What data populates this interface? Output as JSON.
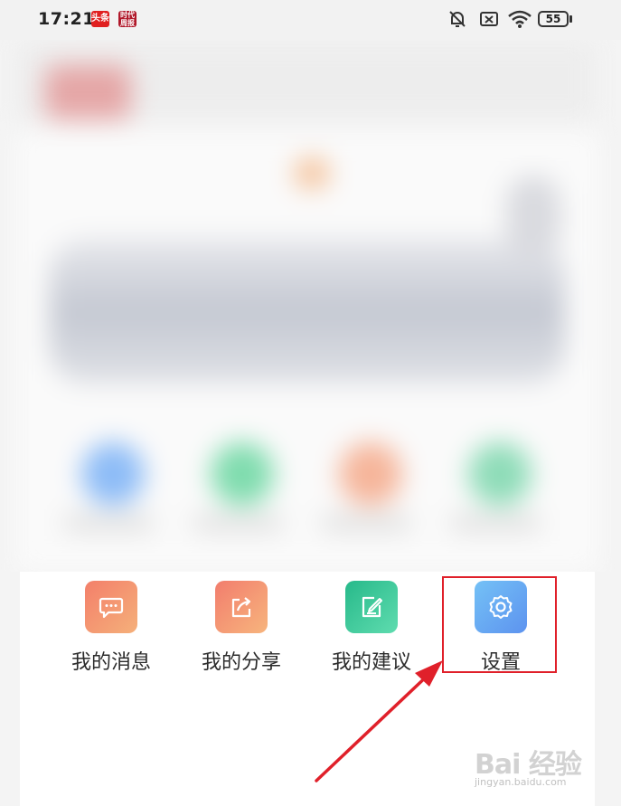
{
  "status_bar": {
    "time": "17:21",
    "app_badge_1": "头条",
    "app_badge_2": "时代周报",
    "battery": "55",
    "icons": [
      "mute-bell-icon",
      "no-sim-icon",
      "wifi-icon",
      "battery-icon"
    ]
  },
  "menu": {
    "items": [
      {
        "label": "我的消息",
        "icon": "message-icon",
        "color": "#f48b6e"
      },
      {
        "label": "我的分享",
        "icon": "share-icon",
        "color": "#f48f70"
      },
      {
        "label": "我的建议",
        "icon": "suggestion-icon",
        "color": "#2fbf8f"
      },
      {
        "label": "设置",
        "icon": "gear-icon",
        "color": "#6aaef3"
      }
    ]
  },
  "annotation": {
    "highlight_color": "#e0202a"
  },
  "watermark": {
    "brand": "Bai 经验",
    "url": "jingyan.baidu.com"
  }
}
